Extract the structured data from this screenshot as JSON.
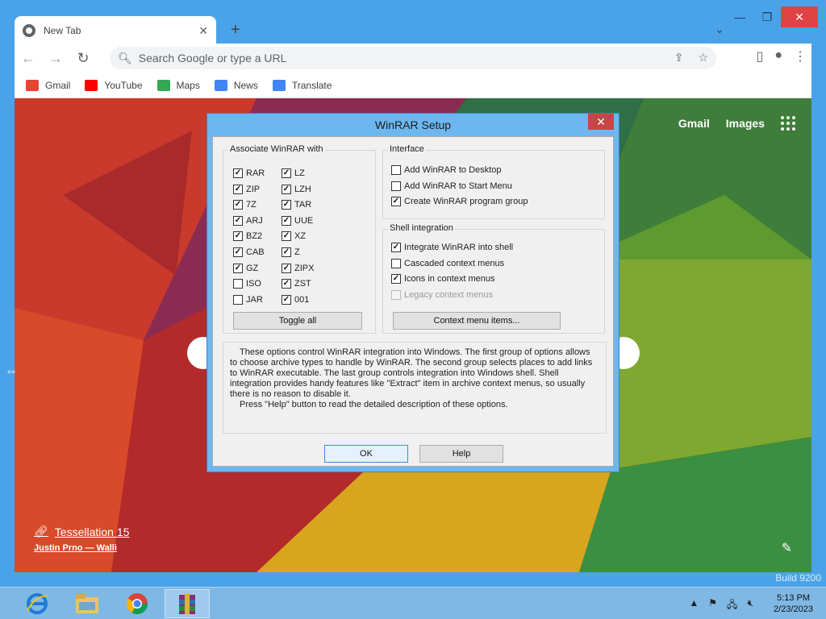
{
  "browser": {
    "tab": {
      "title": "New Tab"
    },
    "omnibox": {
      "placeholder": "Search Google or type a URL"
    },
    "bookmarks": [
      {
        "label": "Gmail",
        "color": "#ea4335"
      },
      {
        "label": "YouTube",
        "color": "#ff0000"
      },
      {
        "label": "Maps",
        "color": "#34a853"
      },
      {
        "label": "News",
        "color": "#4285f4"
      },
      {
        "label": "Translate",
        "color": "#4285f4"
      }
    ],
    "ntp": {
      "gmail": "Gmail",
      "images": "Images",
      "attribution_title": "Tessellation 15",
      "attribution_author": "Justin Prno — Walli"
    }
  },
  "dialog": {
    "title": "WinRAR Setup",
    "associate": {
      "title": "Associate WinRAR with",
      "col1": [
        {
          "label": "RAR",
          "checked": true
        },
        {
          "label": "ZIP",
          "checked": true
        },
        {
          "label": "7Z",
          "checked": true
        },
        {
          "label": "ARJ",
          "checked": true
        },
        {
          "label": "BZ2",
          "checked": true
        },
        {
          "label": "CAB",
          "checked": true
        },
        {
          "label": "GZ",
          "checked": true
        },
        {
          "label": "ISO",
          "checked": false
        },
        {
          "label": "JAR",
          "checked": false
        }
      ],
      "col2": [
        {
          "label": "LZ",
          "checked": true
        },
        {
          "label": "LZH",
          "checked": true
        },
        {
          "label": "TAR",
          "checked": true
        },
        {
          "label": "UUE",
          "checked": true
        },
        {
          "label": "XZ",
          "checked": true
        },
        {
          "label": "Z",
          "checked": true
        },
        {
          "label": "ZIPX",
          "checked": true
        },
        {
          "label": "ZST",
          "checked": true
        },
        {
          "label": "001",
          "checked": true
        }
      ],
      "toggle_all": "Toggle all"
    },
    "interface": {
      "title": "Interface",
      "items": [
        {
          "label": "Add WinRAR to Desktop",
          "checked": false
        },
        {
          "label": "Add WinRAR to Start Menu",
          "checked": false
        },
        {
          "label": "Create WinRAR program group",
          "checked": true
        }
      ]
    },
    "shell": {
      "title": "Shell integration",
      "items": [
        {
          "label": "Integrate WinRAR into shell",
          "checked": true,
          "disabled": false
        },
        {
          "label": "Cascaded context menus",
          "checked": false,
          "disabled": false
        },
        {
          "label": "Icons in context menus",
          "checked": true,
          "disabled": false
        },
        {
          "label": "Legacy context menus",
          "checked": false,
          "disabled": true
        }
      ],
      "context_button": "Context menu items..."
    },
    "description": [
      "These options control WinRAR integration into Windows. The first group of options allows to choose archive types to handle by WinRAR. The second group selects places to add links to WinRAR executable. The last group controls integration into Windows shell. Shell integration provides handy features like \"Extract\" item in archive context menus, so usually there is no reason to disable it.",
      "Press \"Help\" button to read the detailed description of these options."
    ],
    "ok": "OK",
    "help": "Help"
  },
  "taskbar": {
    "time": "5:13 PM",
    "date": "2/23/2023",
    "build_watermark": "Build 9200"
  }
}
